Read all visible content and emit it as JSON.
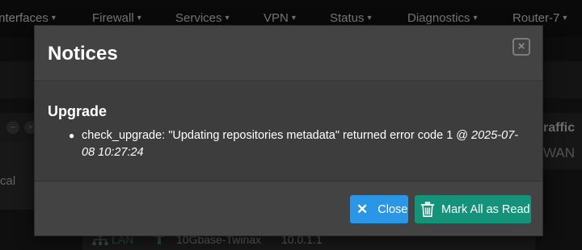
{
  "navbar": {
    "items": [
      {
        "label": "Interfaces"
      },
      {
        "label": "Firewall"
      },
      {
        "label": "Services"
      },
      {
        "label": "VPN"
      },
      {
        "label": "Status"
      },
      {
        "label": "Diagnostics"
      },
      {
        "label": "Router-7"
      }
    ],
    "caret": "▾"
  },
  "background": {
    "left_panel_text": "cal",
    "left_panel_buttons": [
      "−",
      "×"
    ],
    "right_panel_title": "raffic",
    "right_panel_sub": "WAN",
    "table_row": {
      "interface": "LAN",
      "media": "10Gbase-Twinax",
      "ip": "10.0.1.1"
    }
  },
  "modal": {
    "title": "Notices",
    "close_glyph": "×",
    "section_title": "Upgrade",
    "notice": {
      "message": "check_upgrade: \"Updating repositories metadata\" returned error code 1 @ ",
      "timestamp": "2025-07-08 10:27:24"
    },
    "buttons": {
      "close_label": "Close",
      "mark_all_label": "Mark All as Read"
    },
    "colors": {
      "close_button": "#2b95e6",
      "mark_all_button": "#15927a"
    }
  }
}
